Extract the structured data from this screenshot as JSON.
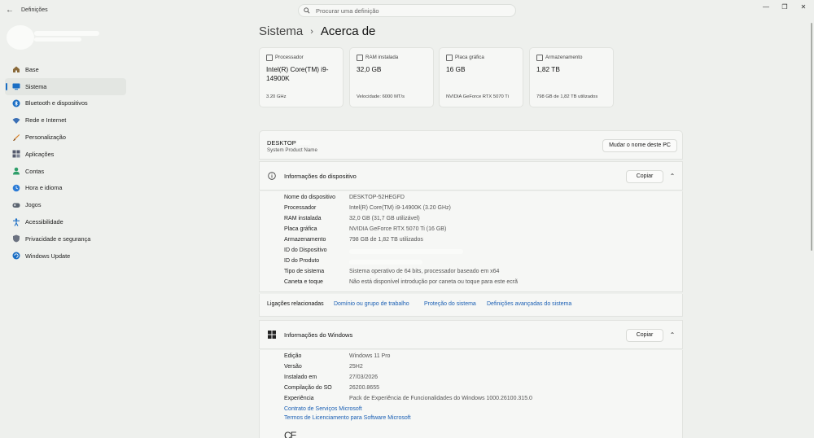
{
  "window": {
    "title": "Definições",
    "controls": [
      "—",
      "❐",
      "✕"
    ]
  },
  "search": {
    "placeholder": "Procurar uma definição"
  },
  "sidebar": {
    "items": [
      {
        "label": "Base",
        "icon": "home-icon",
        "color": "#8a6a3a"
      },
      {
        "label": "Sistema",
        "icon": "monitor-icon",
        "color": "#1a6ec4"
      },
      {
        "label": "Bluetooth e dispositivos",
        "icon": "bluetooth-icon",
        "color": "#1a6ec4"
      },
      {
        "label": "Rede e Internet",
        "icon": "wifi-icon",
        "color": "#3a6fb5"
      },
      {
        "label": "Personalização",
        "icon": "brush-icon",
        "color": "#d9822b"
      },
      {
        "label": "Aplicações",
        "icon": "apps-icon",
        "color": "#555b6e"
      },
      {
        "label": "Contas",
        "icon": "person-icon",
        "color": "#2e9e6a"
      },
      {
        "label": "Hora e idioma",
        "icon": "globe-clock-icon",
        "color": "#2b7bd6"
      },
      {
        "label": "Jogos",
        "icon": "gamepad-icon",
        "color": "#5b6470"
      },
      {
        "label": "Acessibilidade",
        "icon": "accessibility-icon",
        "color": "#1a6ec4"
      },
      {
        "label": "Privacidade e segurança",
        "icon": "shield-icon",
        "color": "#6b7280"
      },
      {
        "label": "Windows Update",
        "icon": "update-icon",
        "color": "#1a6ec4"
      }
    ]
  },
  "breadcrumb": {
    "parent": "Sistema",
    "separator": "›",
    "current": "Acerca de"
  },
  "cards": [
    {
      "label": "Processador",
      "value": "Intel(R) Core(TM) i9-14900K",
      "sub": "3.20 GHz",
      "icon": "processor-icon"
    },
    {
      "label": "RAM instalada",
      "value": "32,0 GB",
      "sub": "Velocidade: 6000 MT/s",
      "icon": "memory-icon"
    },
    {
      "label": "Placa gráfica",
      "value": "16 GB",
      "sub": "NVIDIA GeForce RTX 5070 Ti",
      "icon": "gpu-icon"
    },
    {
      "label": "Armazenamento",
      "value": "1,82 TB",
      "sub": "798 GB de 1,82 TB utilizados",
      "icon": "storage-icon"
    }
  ],
  "device": {
    "name": "DESKTOP",
    "model": "System Product Name",
    "rename_label": "Mudar o nome deste PC"
  },
  "device_info": {
    "title": "Informações do dispositivo",
    "copy_label": "Copiar",
    "rows": [
      {
        "key": "Nome do dispositivo",
        "value": "DESKTOP-52HEGFD"
      },
      {
        "key": "Processador",
        "value": "Intel(R) Core(TM) i9-14900K (3.20 GHz)"
      },
      {
        "key": "RAM instalada",
        "value": "32,0 GB (31,7 GB utilizável)"
      },
      {
        "key": "Placa gráfica",
        "value": "NVIDIA GeForce RTX 5070 Ti (16 GB)"
      },
      {
        "key": "Armazenamento",
        "value": "798 GB de 1,82 TB utilizados"
      },
      {
        "key": "ID do Dispositivo",
        "value": ""
      },
      {
        "key": "ID do Produto",
        "value": ""
      },
      {
        "key": "Tipo de sistema",
        "value": "Sistema operativo de 64 bits, processador baseado em x64"
      },
      {
        "key": "Caneta e toque",
        "value": "Não está disponível introdução por caneta ou toque para este ecrã"
      }
    ]
  },
  "related": {
    "label": "Ligações relacionadas",
    "links": [
      "Domínio ou grupo de trabalho",
      "Proteção do sistema",
      "Definições avançadas do sistema"
    ]
  },
  "windows_info": {
    "title": "Informações do Windows",
    "copy_label": "Copiar",
    "rows": [
      {
        "key": "Edição",
        "value": "Windows 11 Pro"
      },
      {
        "key": "Versão",
        "value": "25H2"
      },
      {
        "key": "Instalado em",
        "value": "27/03/2026"
      },
      {
        "key": "Compilação do SO",
        "value": "26200.8655"
      },
      {
        "key": "Experiência",
        "value": "Pack de Experiência de Funcionalidades do Windows 1000.26100.315.0"
      }
    ],
    "links": [
      "Contrato de Serviços Microsoft",
      "Termos de Licenciamento para Software Microsoft"
    ],
    "ce_mark": "CE"
  }
}
